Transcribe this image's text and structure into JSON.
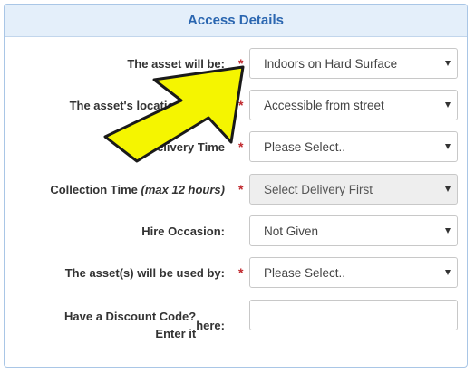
{
  "panel": {
    "title": "Access Details"
  },
  "fields": {
    "asset_will_be": {
      "label": "The asset will be:",
      "required": "*",
      "value": "Indoors on Hard Surface"
    },
    "asset_location": {
      "label": "The asset's location will be:",
      "required": "*",
      "value": "Accessible from street"
    },
    "delivery_time": {
      "label": "Delivery Time",
      "required": "*",
      "value": "Please Select.."
    },
    "collection_time": {
      "label": "Collection Time",
      "label_note": "(max 12 hours)",
      "required": "*",
      "value": "Select Delivery First",
      "disabled": true
    },
    "hire_occasion": {
      "label": "Hire Occasion:",
      "value": "Not Given"
    },
    "used_by": {
      "label": "The asset(s) will be used by:",
      "required": "*",
      "value": "Please Select.."
    },
    "discount_code": {
      "label_line1": "Have a Discount Code? Enter it",
      "label_line2": "here:",
      "value": ""
    }
  },
  "annotation": {
    "icon": "yellow-pointer-arrow-icon",
    "color": "#f5f500"
  }
}
